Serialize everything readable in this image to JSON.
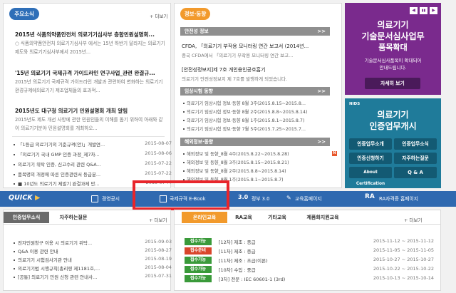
{
  "colors": {
    "news_tag": "#2f6fb8",
    "info_tag": "#f29a2c",
    "quick_bar": "#2f69b0",
    "banner1": "#7a2a8d",
    "banner2": "#1f7b9a",
    "badge_green": "#3a9a3a",
    "badge_red": "#d9452b",
    "highlight": "#e8252b"
  },
  "news": {
    "tag": "주요소식",
    "more": "+ 더보기",
    "items": [
      {
        "title": "2015년 식품의약품안전처 의료기기심사부 층합민원설명회...",
        "body": "○ 식품의약품안전처 의료기기심사부 에서는 15년 하반기 달라지는 의료기기 제도와 의료기기심사부에서 2015년..."
      },
      {
        "title": "'15년 의료기기 국제규격 가이드라인 연구사업_관련 완결규...",
        "body": "2015년 의료기기 국제규격 가이드라인 개발과 관련하여 변화하는 의료기기 환경규제에의료기기 제조업체들의 효과적..."
      },
      {
        "title": "2015년도 대구청 의료기기 민원설명회 개최 알림",
        "body": "2015년도 제도 개선 사항에 관한 민원인들의 이해를 돕기 위하여 아래와 같이 의료기기분야 민원설명회를 개최하오..."
      }
    ],
    "list": [
      {
        "title": "「1등급 의료기기의 기준규격(안)」개발연...",
        "date": "2015-08-07"
      },
      {
        "title": "「의료기기 국내 GMP 인증 과정_제7차...",
        "date": "2015-08-06"
      },
      {
        "title": "의료기기 위탁 인증, 신고수리 관련 Q&A...",
        "date": "2015-07-22"
      },
      {
        "title": "품목명의 개정에 따른 인증관련서 등급분...",
        "date": "2015-07-22"
      },
      {
        "title": "■ 10년도 의료기기 제발기 완결과제 만...",
        "date": "2015-07-??"
      }
    ]
  },
  "info": {
    "tag": "정보·동향",
    "sections": [
      {
        "label": "안전성 정보",
        "arrow": ">>"
      },
      {
        "label": "임상시험 동향",
        "arrow": ">>"
      },
      {
        "label": "해외정보·동향",
        "arrow": ">>"
      }
    ],
    "safety": [
      {
        "title": "CFDA, 「의료기기 부작용 모니터링 연간 보고서 (2014년...",
        "body": "중국 CFDA에서 「의료기기 부작용 모니터링 연간 보고..."
      },
      {
        "title": "[안전성정보지]제 7호 개인용인공호흡기",
        "body": "의료기기 안전성정보지 제 7호를 발행하게 되었습니다."
      }
    ],
    "clinical": [
      "의료기기 임상시험 정보·동향 8월 3주(2015.8.15~2015.8...",
      "의료기기 임상시험 정보·동향 8월 2주(2015.8.8~2015.8.14)",
      "의료기기 임상시험 정보·동향 8월 1주(2015.8.1~2015.8.7)",
      "의료기기 임상시험 정보·동향 7월 5주(2015.7.25~2015.7..."
    ],
    "overseas": [
      "해외정보 및 동향_8월 4주(2015.8.22~2015.8.28)",
      "해외정보 및 동향_8월 3주(2015.8.15~2015.8.21)",
      "해외정보 및 동향_8월 2주(2015.8.8~2015.8.14)",
      "해외정보 및 동향_8월 1주(2015.8.1~2015.8.7)"
    ],
    "new_badge": "N"
  },
  "banner1": {
    "line1": "의료기기",
    "line2": "기술문서심사업무",
    "line3": "품목확대",
    "sub1": "기술문서심사품목이 확대되어",
    "sub2": "안내드립니다.",
    "button": "자세히 보기",
    "nav": [
      "◀",
      "▮▮",
      "▶"
    ]
  },
  "banner2": {
    "logo": "NIDS",
    "line1": "의료기기",
    "line2": "인증업무개시",
    "buttons": [
      "인증업무소개",
      "인증업무소식",
      "인증신청하기",
      "자주하는질문",
      "About Certification",
      "Q & A"
    ]
  },
  "quick": {
    "label": "QUICK",
    "items": [
      "경영공시",
      "국제규격 E-Book",
      "3.0",
      "정부 3.0",
      "교육홈페이지",
      "RA",
      "RA자격증 홈페이지"
    ]
  },
  "bottom_left": {
    "tabs": [
      "인증업무소식",
      "자주하는질문"
    ],
    "more": "+ 더보기",
    "rows": [
      {
        "title": "전자민원창구 이용 시 의료기기 위탁...",
        "date": "2015-09-03"
      },
      {
        "title": "Q&A 이용 관련 안내",
        "date": "2015-08-27"
      },
      {
        "title": "의료기기 시험검사기관 안내",
        "date": "2015-08-19"
      },
      {
        "title": "의료기기법 시행규칙[총리령 제1181호,...",
        "date": "2015-08-04"
      },
      {
        "title": "[공통] 의료기기 민원 신청 관련 안내사...",
        "date": "2015-07-31"
      }
    ]
  },
  "bottom_right": {
    "tabs": [
      "온라인교육",
      "RA교육",
      "기타교육",
      "제품화지원교육"
    ],
    "more": "+ 더보기",
    "rows": [
      {
        "badge": "접수가능",
        "badge_color": "green",
        "title": "[12차] 제조 : 중급",
        "period": "2015-11-12 ~ 2015-11-12"
      },
      {
        "badge": "접수준비",
        "badge_color": "red",
        "title": "[11차] 제조 : 중급",
        "period": "2015-11-05 ~ 2015-11-05"
      },
      {
        "badge": "접수가능",
        "badge_color": "green",
        "title": "[11차] 제조 : 초급(이론)",
        "period": "2015-10-27 ~ 2015-10-27"
      },
      {
        "badge": "접수가능",
        "badge_color": "green",
        "title": "[10차] 수입 : 중급",
        "period": "2015-10-22 ~ 2015-10-22"
      },
      {
        "badge": "접수가능",
        "badge_color": "green",
        "title": "[3차] 전문 : IEC 60601-1 (3rd)",
        "period": "2015-10-13 ~ 2015-10-14"
      }
    ]
  }
}
